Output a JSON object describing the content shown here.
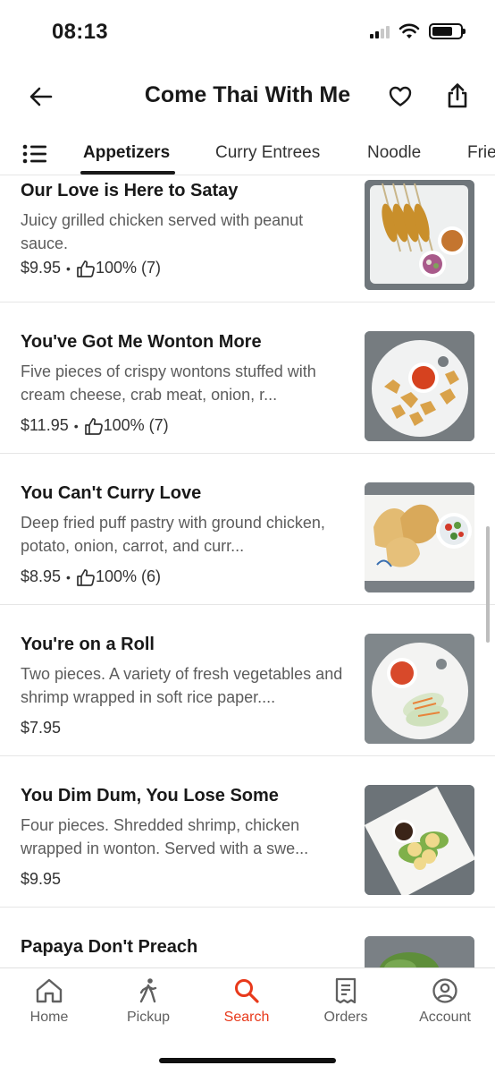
{
  "status_bar": {
    "time": "08:13"
  },
  "header": {
    "store_name": "Come Thai With Me"
  },
  "tabs": [
    {
      "label": "Appetizers",
      "active": true
    },
    {
      "label": "Curry Entrees",
      "active": false
    },
    {
      "label": "Noodle",
      "active": false
    },
    {
      "label": "Frie",
      "active": false
    }
  ],
  "items": [
    {
      "name": "Our Love is Here to Satay",
      "description": "Juicy grilled chicken served with peanut sauce.",
      "price": "$9.95",
      "rating": "100% (7)",
      "image": "chicken-satay-with-peanut-sauce"
    },
    {
      "name": "You've Got Me Wonton More",
      "description": "Five pieces of crispy wontons stuffed with cream cheese, crab meat, onion, r...",
      "price": "$11.95",
      "rating": "100% (7)",
      "image": "crab-rangoon-wontons"
    },
    {
      "name": "You Can't Curry Love",
      "description": "Deep fried puff pastry with ground chicken, potato, onion, carrot, and curr...",
      "price": "$8.95",
      "rating": "100% (6)",
      "image": "curry-puffs-with-cucumber-salad"
    },
    {
      "name": "You're on a Roll",
      "description": "Two pieces. A variety of fresh vegetables and shrimp wrapped in soft rice paper....",
      "price": "$7.95",
      "rating": "",
      "image": "fresh-rolls-with-sauce"
    },
    {
      "name": "You Dim Dum, You Lose Some",
      "description": "Four pieces. Shredded shrimp, chicken wrapped in wonton. Served with a swe...",
      "price": "$9.95",
      "rating": "",
      "image": "dim-sum-dumplings"
    },
    {
      "name": "Papaya Don't Preach",
      "description": "",
      "price": "",
      "rating": "",
      "image": "papaya-salad"
    }
  ],
  "bottom_nav": [
    {
      "label": "Home",
      "icon": "home-icon",
      "active": false
    },
    {
      "label": "Pickup",
      "icon": "pickup-walk-icon",
      "active": false
    },
    {
      "label": "Search",
      "icon": "search-icon",
      "active": true
    },
    {
      "label": "Orders",
      "icon": "orders-receipt-icon",
      "active": false
    },
    {
      "label": "Account",
      "icon": "account-icon",
      "active": false
    }
  ],
  "colors": {
    "accent": "#e8391b",
    "text": "#191919",
    "muted": "#5c5c5c"
  }
}
